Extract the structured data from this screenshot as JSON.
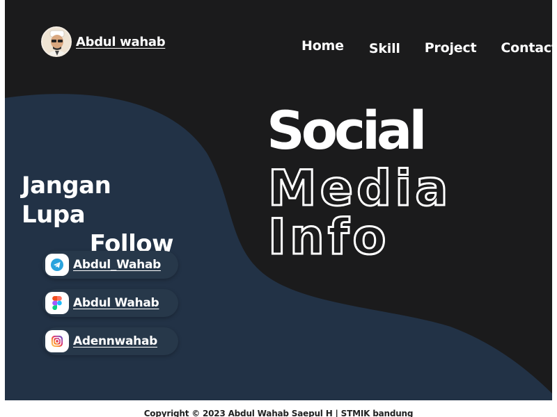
{
  "header": {
    "brand_name": "Abdul wahab",
    "nav": [
      {
        "label": "Home"
      },
      {
        "label": "Skill"
      },
      {
        "label": "Project"
      },
      {
        "label": "Contact"
      }
    ]
  },
  "hero": {
    "title_line1": "Social",
    "title_line2": "Media Info",
    "tagline_line1": "Jangan Lupa",
    "tagline_line2": "Follow"
  },
  "social": [
    {
      "icon": "telegram-icon",
      "label": "Abdul_Wahab"
    },
    {
      "icon": "figma-icon",
      "label": "Abdul Wahab"
    },
    {
      "icon": "instagram-icon",
      "label": "Adennwahab"
    }
  ],
  "footer": {
    "text": "Copyright © 2023 Abdul Wahab Saepul H | STMIK bandung"
  },
  "colors": {
    "background": "#1b1b1c",
    "wave": "#223246",
    "pill": "#27384a",
    "text": "#ffffff"
  }
}
